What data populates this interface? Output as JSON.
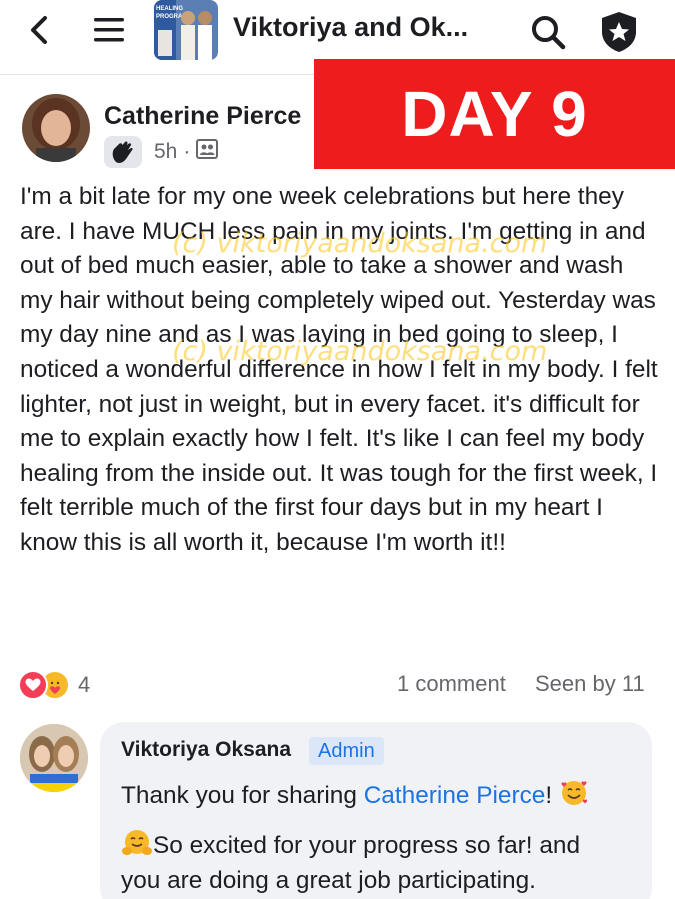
{
  "topbar": {
    "back_icon": "chevron-left-icon",
    "menu_icon": "hamburger-menu-icon",
    "group_thumb_text": "HEALING\nPROGRAM",
    "group_title": "Viktoriya and Ok...",
    "search_icon": "search-icon",
    "admin_icon": "shield-star-icon"
  },
  "banner": {
    "text": "DAY 9",
    "color": "#ee1c1c"
  },
  "post": {
    "author": "Catherine Pierce",
    "badge_icon": "waving-hand-icon",
    "time": "5h",
    "separator": "·",
    "audience_icon": "group-audience-icon",
    "body": "I'm a bit late for my one week celebrations but here they are. I have MUCH less pain in my joints. I'm getting in and out of bed much easier, able to take a shower and wash my hair without being completely wiped out. Yesterday was my day nine and as I was laying in bed going to sleep, I noticed a wonderful difference in how I felt in my body. I felt lighter, not just in weight, but in every facet. it's difficult for me to explain exactly how I felt. It's like I can feel my body healing from the inside out. It was tough for the first week, I felt terrible much of the first four days but in my heart I know this is all worth it, because I'm worth it!!",
    "watermark": "(c) viktoriyaandoksana.com"
  },
  "stats": {
    "reaction_icons": [
      "love-reaction-icon",
      "care-reaction-icon"
    ],
    "reaction_count": "4",
    "comment_count": "1 comment",
    "seen_by": "Seen by 11"
  },
  "comment": {
    "author": "Viktoriya Oksana",
    "role_badge": "Admin",
    "text_prefix": "Thank you for sharing ",
    "mention": "Catherine Pierce",
    "text_suffix": "!",
    "line2": "So excited for your progress so far! and",
    "line3": "you are doing a great job participating."
  },
  "colors": {
    "link": "#1b74e4",
    "secondary_text": "#65676b",
    "bubble_bg": "#f0f2f5"
  }
}
